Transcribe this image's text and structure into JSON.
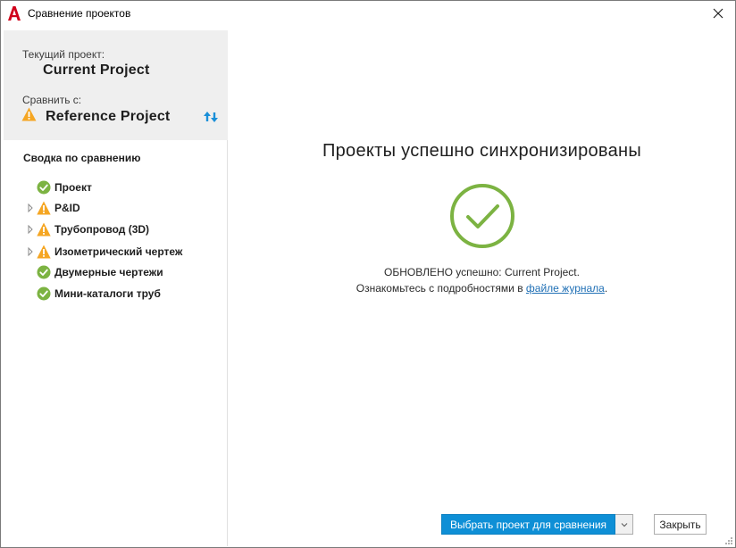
{
  "window": {
    "title": "Сравнение проектов",
    "app_icon": "autocad-a-icon",
    "close_icon": "close-icon"
  },
  "left_panel": {
    "current_label": "Текущий проект:",
    "current_project": "Current Project",
    "compare_label": "Сравнить с:",
    "reference_project": "Reference Project",
    "reference_status_icon": "warning-icon",
    "swap_icon": "swap-arrows-icon",
    "summary_title": "Сводка по сравнению",
    "tree": [
      {
        "label": "Проект",
        "status": "ok",
        "expandable": false
      },
      {
        "label": "P&ID",
        "status": "warning",
        "expandable": true
      },
      {
        "label": "Трубопровод (3D)",
        "status": "warning",
        "expandable": true
      },
      {
        "label": "Изометрический чертеж",
        "status": "warning",
        "expandable": true
      },
      {
        "label": "Двумерные чертежи",
        "status": "ok",
        "expandable": false
      },
      {
        "label": "Мини-каталоги труб",
        "status": "ok",
        "expandable": false
      }
    ]
  },
  "main": {
    "headline": "Проекты успешно синхронизированы",
    "success_icon": "success-check-circle-icon",
    "message_line1": "ОБНОВЛЕНО успешно: Current Project.",
    "message_line2_prefix": "Ознакомьтесь с подробностями в ",
    "message_link": "файле журнала",
    "message_line2_suffix": "."
  },
  "buttons": {
    "select_project": "Выбрать проект для сравнения",
    "close": "Закрыть"
  },
  "colors": {
    "accent_blue": "#0e8fd6",
    "success_green": "#7cb342",
    "warning_orange": "#f5a623",
    "link_blue": "#1f6fb5",
    "header_gray": "#efefef"
  }
}
